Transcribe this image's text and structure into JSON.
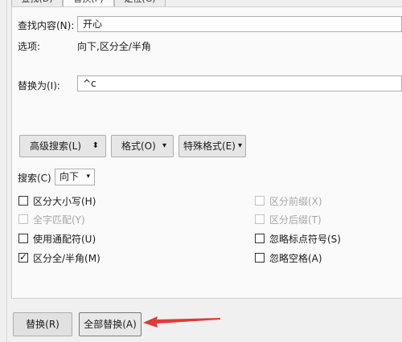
{
  "tabs": [
    {
      "label": "查找(D)",
      "active": false
    },
    {
      "label": "替换(P)",
      "active": true
    },
    {
      "label": "定位(G)",
      "active": false
    }
  ],
  "find": {
    "label": "查找内容(N):",
    "value": "开心"
  },
  "options": {
    "label": "选项:",
    "value": "向下,区分全/半角"
  },
  "replace": {
    "label": "替换为(I):",
    "value": "^c"
  },
  "buttons": {
    "advanced_search": "高级搜索(L)",
    "advanced_search_arrow": "⬍",
    "format": "格式(O)",
    "format_arrow": "▾",
    "special_format": "特殊格式(E)",
    "special_format_arrow": "▾"
  },
  "search": {
    "label": "搜索(C)",
    "value": "向下",
    "arrow": "▾"
  },
  "checkboxes_left": [
    {
      "label": "区分大小写(H)",
      "checked": false,
      "disabled": false
    },
    {
      "label": "全字匹配(Y)",
      "checked": false,
      "disabled": true
    },
    {
      "label": "使用通配符(U)",
      "checked": false,
      "disabled": false
    },
    {
      "label": "区分全/半角(M)",
      "checked": true,
      "disabled": false
    }
  ],
  "checkboxes_right": [
    {
      "label": "区分前缀(X)",
      "checked": false,
      "disabled": true
    },
    {
      "label": "区分后缀(T)",
      "checked": false,
      "disabled": true
    },
    {
      "label": "忽略标点符号(S)",
      "checked": false,
      "disabled": false
    },
    {
      "label": "忽略空格(A)",
      "checked": false,
      "disabled": false
    }
  ],
  "check_mark": "✓",
  "bottom": {
    "replace": "替换(R)",
    "replace_all": "全部替换(A)"
  },
  "colors": {
    "annotation_arrow": "#e53935"
  }
}
